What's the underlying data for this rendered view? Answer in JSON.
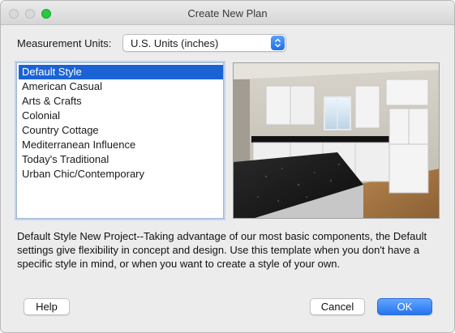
{
  "window": {
    "title": "Create New Plan"
  },
  "units": {
    "label": "Measurement Units:",
    "selected": "U.S. Units (inches)"
  },
  "styles": {
    "items": [
      "Default Style",
      "American Casual",
      "Arts & Crafts",
      "Colonial",
      "Country Cottage",
      "Mediterranean Influence",
      "Today's Traditional",
      "Urban Chic/Contemporary"
    ],
    "selected_index": 0
  },
  "preview": {
    "description": "kitchen render preview"
  },
  "description": "Default Style New Project--Taking advantage of our most basic components, the Default settings give flexibility in concept and design. Use this template when you don't have a specific style in mind, or when you want to create a style of your own.",
  "buttons": {
    "help": "Help",
    "cancel": "Cancel",
    "ok": "OK"
  },
  "colors": {
    "accent": "#1b63d5",
    "default_button": "#2474ee"
  }
}
